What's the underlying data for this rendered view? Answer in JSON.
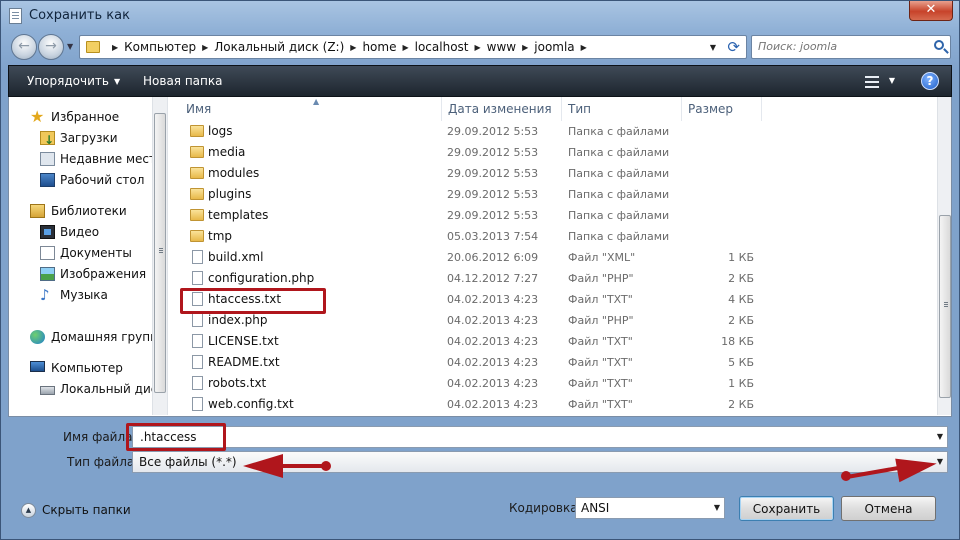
{
  "window": {
    "title": "Сохранить как",
    "close_glyph": "✕"
  },
  "address": {
    "crumbs": [
      "Компьютер",
      "Локальный диск (Z:)",
      "home",
      "localhost",
      "www",
      "joomla"
    ],
    "search_placeholder": "Поиск: joomla"
  },
  "toolbar": {
    "organize": "Упорядочить",
    "new_folder": "Новая папка",
    "help": "?"
  },
  "nav": {
    "items": [
      {
        "label": "Избранное",
        "icon": "star-icon",
        "level": "top"
      },
      {
        "label": "Загрузки",
        "icon": "downloads-icon",
        "level": "sub"
      },
      {
        "label": "Недавние места",
        "icon": "recent-places-icon",
        "level": "sub"
      },
      {
        "label": "Рабочий стол",
        "icon": "desktop-icon",
        "level": "sub"
      },
      {
        "label": "Библиотеки",
        "icon": "libraries-icon",
        "level": "top"
      },
      {
        "label": "Видео",
        "icon": "video-icon",
        "level": "sub"
      },
      {
        "label": "Документы",
        "icon": "documents-icon",
        "level": "sub"
      },
      {
        "label": "Изображения",
        "icon": "pictures-icon",
        "level": "sub"
      },
      {
        "label": "Музыка",
        "icon": "music-icon",
        "level": "sub"
      },
      {
        "label": "Домашняя группа",
        "icon": "homegroup-icon",
        "level": "top"
      },
      {
        "label": "Компьютер",
        "icon": "computer-icon",
        "level": "top"
      },
      {
        "label": "Локальный диск",
        "icon": "drive-icon",
        "level": "sub"
      }
    ]
  },
  "files": {
    "columns": {
      "name": "Имя",
      "date": "Дата изменения",
      "type": "Тип",
      "size": "Размер"
    },
    "rows": [
      {
        "name": "logs",
        "date": "29.09.2012 5:53",
        "type": "Папка с файлами",
        "size": "",
        "kind": "folder"
      },
      {
        "name": "media",
        "date": "29.09.2012 5:53",
        "type": "Папка с файлами",
        "size": "",
        "kind": "folder"
      },
      {
        "name": "modules",
        "date": "29.09.2012 5:53",
        "type": "Папка с файлами",
        "size": "",
        "kind": "folder"
      },
      {
        "name": "plugins",
        "date": "29.09.2012 5:53",
        "type": "Папка с файлами",
        "size": "",
        "kind": "folder"
      },
      {
        "name": "templates",
        "date": "29.09.2012 5:53",
        "type": "Папка с файлами",
        "size": "",
        "kind": "folder"
      },
      {
        "name": "tmp",
        "date": "05.03.2013 7:54",
        "type": "Папка с файлами",
        "size": "",
        "kind": "folder"
      },
      {
        "name": "build.xml",
        "date": "20.06.2012 6:09",
        "type": "Файл \"XML\"",
        "size": "1 КБ",
        "kind": "file"
      },
      {
        "name": "configuration.php",
        "date": "04.12.2012 7:27",
        "type": "Файл \"PHP\"",
        "size": "2 КБ",
        "kind": "file"
      },
      {
        "name": "htaccess.txt",
        "date": "04.02.2013 4:23",
        "type": "Файл \"TXT\"",
        "size": "4 КБ",
        "kind": "file"
      },
      {
        "name": "index.php",
        "date": "04.02.2013 4:23",
        "type": "Файл \"PHP\"",
        "size": "2 КБ",
        "kind": "file"
      },
      {
        "name": "LICENSE.txt",
        "date": "04.02.2013 4:23",
        "type": "Файл \"TXT\"",
        "size": "18 КБ",
        "kind": "file"
      },
      {
        "name": "README.txt",
        "date": "04.02.2013 4:23",
        "type": "Файл \"TXT\"",
        "size": "5 КБ",
        "kind": "file"
      },
      {
        "name": "robots.txt",
        "date": "04.02.2013 4:23",
        "type": "Файл \"TXT\"",
        "size": "1 КБ",
        "kind": "file"
      },
      {
        "name": "web.config.txt",
        "date": "04.02.2013 4:23",
        "type": "Файл \"TXT\"",
        "size": "2 КБ",
        "kind": "file"
      }
    ]
  },
  "form": {
    "filename_label": "Имя файла:",
    "filename_value": ".htaccess",
    "filetype_label": "Тип файла:",
    "filetype_value": "Все файлы  (*.*)",
    "encoding_label": "Кодировка:",
    "encoding_value": "ANSI",
    "hide_folders": "Скрыть папки",
    "save": "Сохранить",
    "cancel": "Отмена"
  },
  "colors": {
    "highlight": "#b0161c",
    "toolbar": "#1d252e",
    "accent": "#2f64aa"
  }
}
